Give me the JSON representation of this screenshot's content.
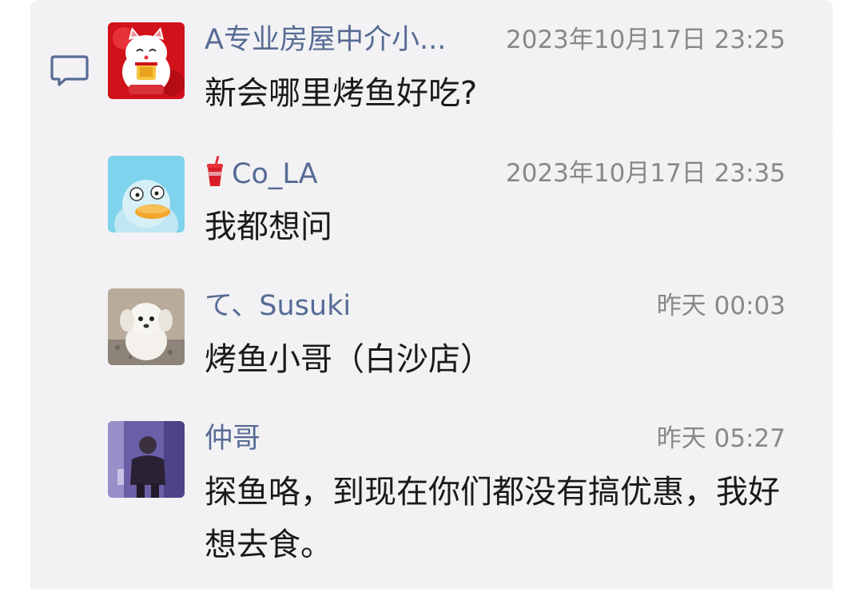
{
  "comments": [
    {
      "author": "A专业房屋中介小...",
      "time": "2023年10月17日 23:25",
      "message": "新会哪里烤鱼好吃?",
      "avatar": "lucky-cat-avatar"
    },
    {
      "author": "Co_LA",
      "author_emoji": "cup-with-straw-icon",
      "time": "2023年10月17日 23:35",
      "message": "我都想问",
      "avatar": "duck-cartoon-avatar"
    },
    {
      "author": "て、Susuki",
      "time": "昨天 00:03",
      "message": "烤鱼小哥（白沙店）",
      "avatar": "white-puppy-avatar"
    },
    {
      "author": "仲哥",
      "time": "昨天 05:27",
      "message": "探鱼咯，到现在你们都没有搞优惠，我好想去食。",
      "avatar": "man-photo-avatar"
    }
  ],
  "colors": {
    "name": "#576b95",
    "time": "#888888",
    "message": "#1a1a1a",
    "panel": "#f2f2f4"
  }
}
